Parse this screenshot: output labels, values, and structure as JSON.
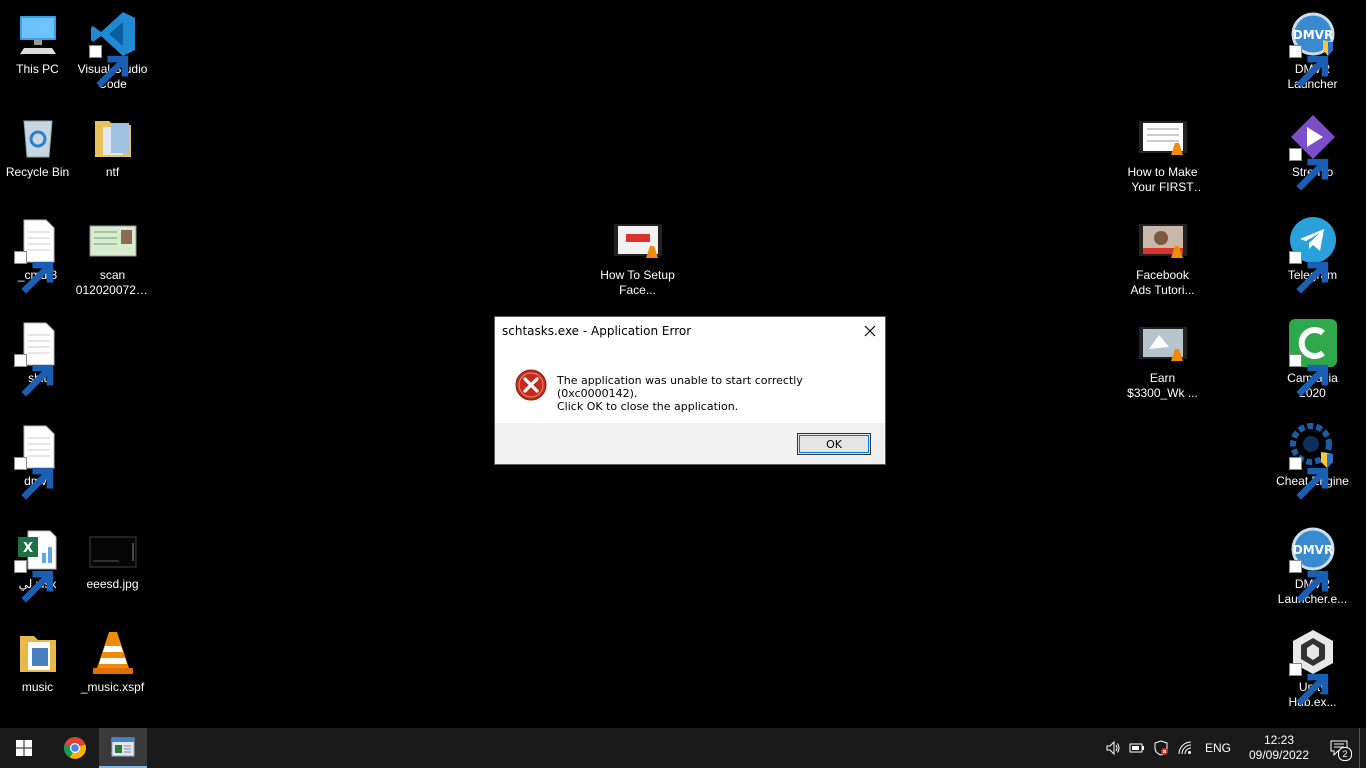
{
  "desktop": {
    "icons": {
      "this_pc": "This PC",
      "vscode": "Visual Studio Code",
      "recycle_bin": "Recycle Bin",
      "ntf": "ntf",
      "cmd3": "_cmd 3",
      "scan": "scan 0120200728...",
      "shit": "shit",
      "dmvr": "dmvr",
      "xlsx": "لي.xlsx",
      "eeesd": "eeesd.jpg",
      "music": "music",
      "music_xspf": "_music.xspf",
      "how_to_setup": "How To Setup Face...",
      "how_to_make": "How to Make Your FIRST ...",
      "facebook_ads": "Facebook Ads Tutori...",
      "earn": "Earn $3300_Wk ...",
      "dmvr_launcher": "DMVR Launcher",
      "stremio": "Stremio",
      "telegram": "Telegram",
      "camtasia": "Camtasia 2020",
      "cheat_engine": "Cheat Engine",
      "dmvr_launcher_exe": "DMVR Launcher.e...",
      "unity_hub": "Unity Hub.ex..."
    }
  },
  "dialog": {
    "title": "schtasks.exe - Application Error",
    "message_line1": "The application was unable to start correctly (0xc0000142).",
    "message_line2": "Click OK to close the application.",
    "ok_label": "OK"
  },
  "taskbar": {
    "language": "ENG",
    "time": "12:23",
    "date": "09/09/2022",
    "notification_count": "2"
  },
  "colors": {
    "desktop_bg": "#000000",
    "taskbar_bg": "#1a1a1a",
    "error_red": "#c42b1c",
    "accent": "#0078d7"
  }
}
